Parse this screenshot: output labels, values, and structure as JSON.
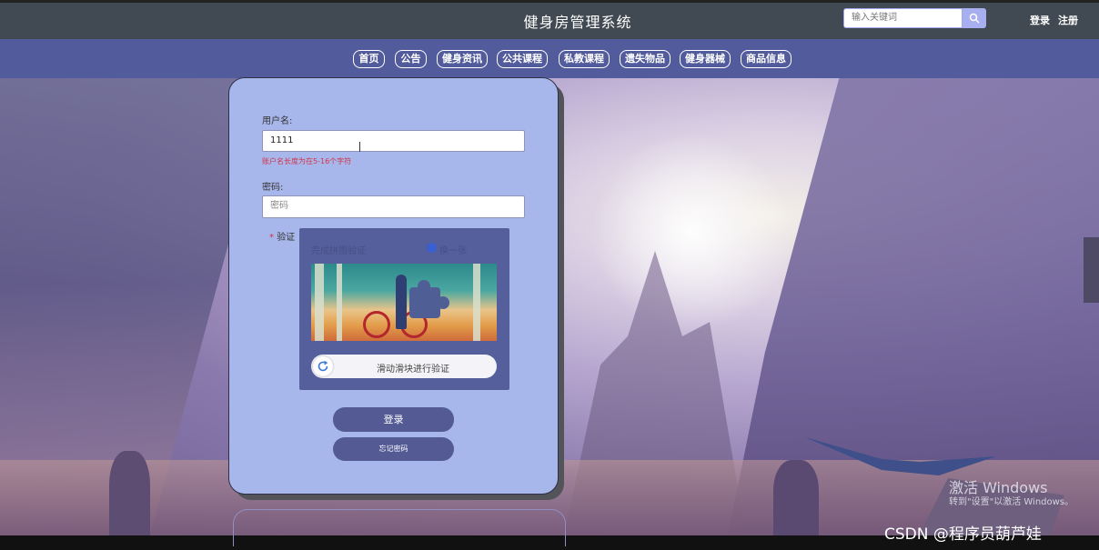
{
  "header": {
    "title": "健身房管理系统",
    "search_placeholder": "输入关键词",
    "login_link": "登录",
    "register_link": "注册"
  },
  "nav": {
    "items": [
      "首页",
      "公告",
      "健身资讯",
      "公共课程",
      "私教课程",
      "遗失物品",
      "健身器械",
      "商品信息"
    ]
  },
  "form": {
    "username_label": "用户名:",
    "username_value": "1111",
    "username_error": "账户名长度为在5-16个字符",
    "password_label": "密码:",
    "password_placeholder": "密码",
    "verify_label": "验证",
    "captcha_title": "完成拼图验证",
    "captcha_refresh": "换一张",
    "slider_text": "滑动滑块进行验证",
    "login_button": "登录",
    "forgot_button": "忘记密码"
  },
  "overlay": {
    "activation_title": "激活 Windows",
    "activation_sub": "转到\"设置\"以激活 Windows。",
    "watermark": "CSDN @程序员葫芦娃"
  },
  "colors": {
    "topbar": "#414a52",
    "navbar": "#525c9c",
    "card": "#a8b7eb",
    "button": "#535a94",
    "error": "#d2334a"
  }
}
